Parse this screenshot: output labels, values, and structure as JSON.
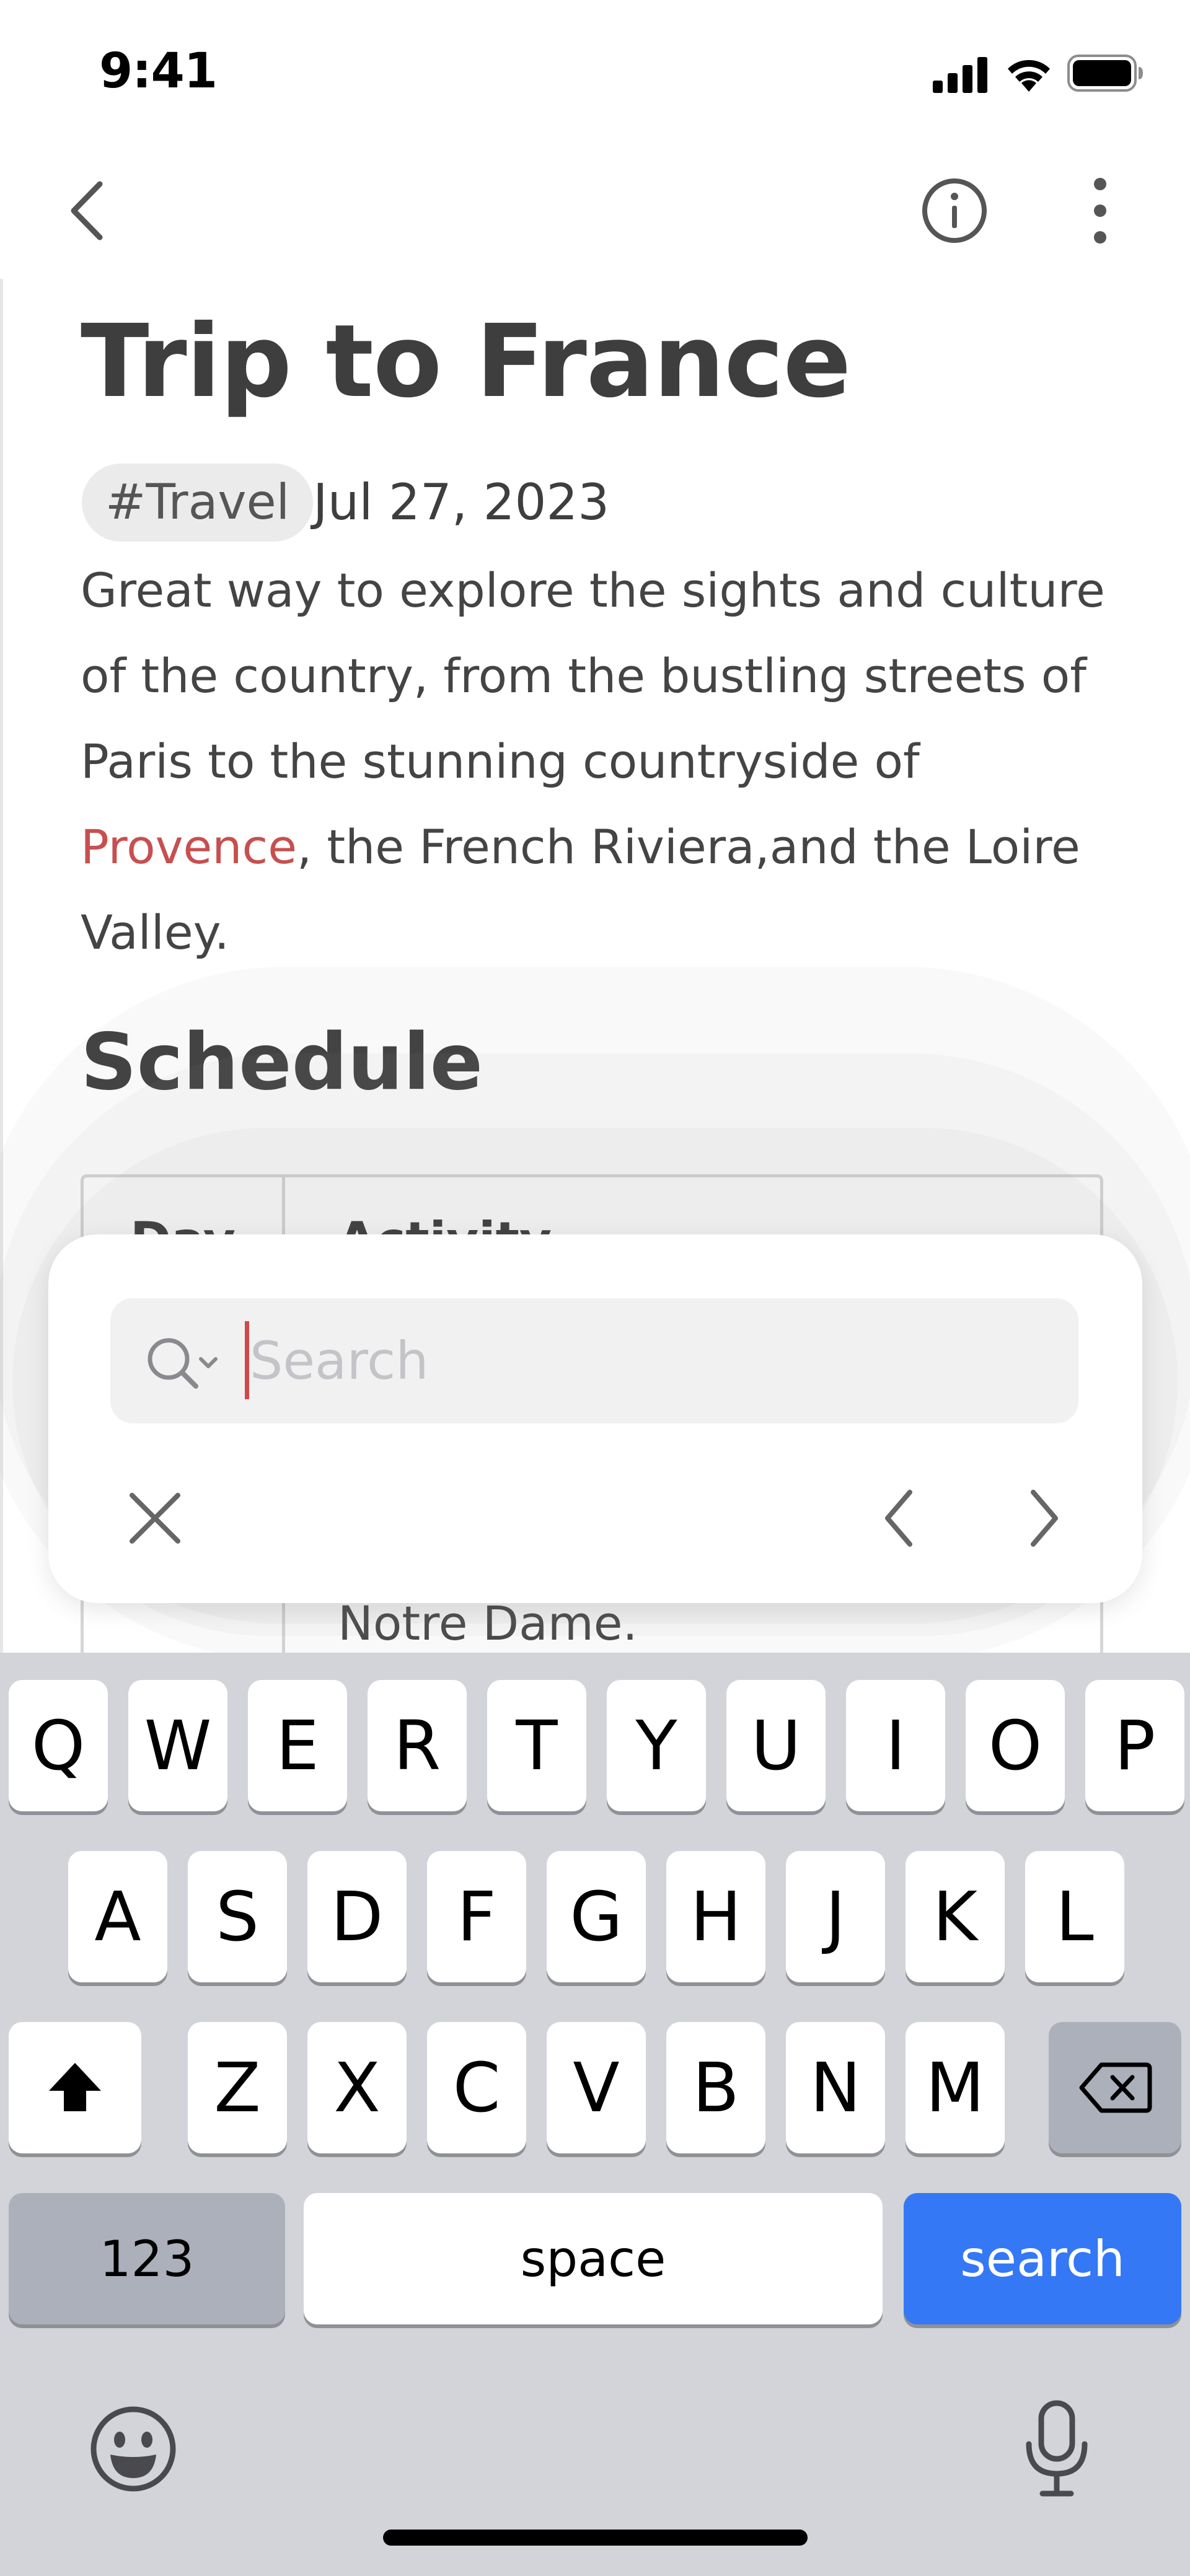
{
  "status_bar": {
    "time": "9:41",
    "icons": [
      "cellular-signal-icon",
      "wifi-icon",
      "battery-icon"
    ]
  },
  "nav": {
    "back_icon": "chevron-left-icon",
    "info_icon": "info-icon",
    "more_icon": "vertical-ellipsis-icon"
  },
  "note": {
    "title": "Trip to France",
    "tag": "#Travel",
    "date": "Jul 27, 2023",
    "body": {
      "part1": "Great way to explore the sights and culture of the country, from the bustling streets of Paris to the stunning countryside of ",
      "link": "Provence",
      "part2": ", the French Riviera,and the Loire Valley."
    },
    "section_heading": "Schedule",
    "table": {
      "headers": [
        "Day",
        "Activity"
      ],
      "visible_cell_text": "Notre Dame."
    }
  },
  "find_panel": {
    "placeholder": "Search",
    "value": "",
    "search_icon": "search-options-icon",
    "close_icon": "close-icon",
    "prev_icon": "chevron-left-icon",
    "next_icon": "chevron-right-icon"
  },
  "keyboard": {
    "row1": [
      "Q",
      "W",
      "E",
      "R",
      "T",
      "Y",
      "U",
      "I",
      "O",
      "P"
    ],
    "row2": [
      "A",
      "S",
      "D",
      "F",
      "G",
      "H",
      "J",
      "K",
      "L"
    ],
    "row3": [
      "Z",
      "X",
      "C",
      "V",
      "B",
      "N",
      "M"
    ],
    "numbers_key": "123",
    "space_key": "space",
    "search_key": "search",
    "shift_icon": "shift-icon",
    "delete_icon": "backspace-icon",
    "emoji_icon": "emoji-icon",
    "mic_icon": "microphone-icon"
  },
  "colors": {
    "accent_link": "#c84f4f",
    "caret": "#d14848",
    "search_key": "#3478f6",
    "keyboard_bg": "#d2d4d9"
  }
}
